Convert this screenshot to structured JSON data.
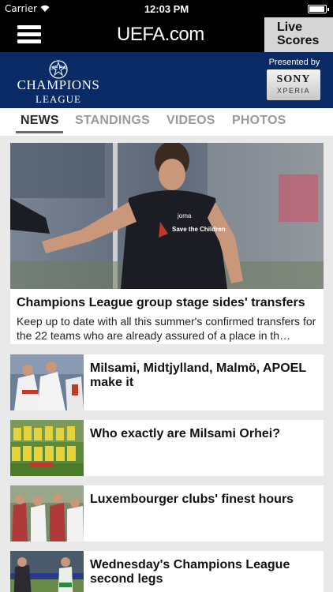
{
  "status_bar": {
    "carrier": "Carrier",
    "time": "12:03 PM"
  },
  "header": {
    "logo_text": "UEFA.com",
    "live_scores_line1": "Live",
    "live_scores_line2": "Scores"
  },
  "banner": {
    "logo_uefa": "UEFA",
    "logo_name": "CHAMPIONS",
    "logo_league": "LEAGUE",
    "presented_by": "Presented by",
    "sponsor": "SONY",
    "sponsor_sub": "XPERIA"
  },
  "tabs": [
    {
      "label": "NEWS",
      "active": true
    },
    {
      "label": "STANDINGS",
      "active": false
    },
    {
      "label": "VIDEOS",
      "active": false
    },
    {
      "label": "PHOTOS",
      "active": false
    }
  ],
  "lead_article": {
    "title": "Champions League group stage sides' transfers",
    "summary": "Keep up to date with all this summer's confirmed transfers for the 22 teams who are already assured of a place in th…",
    "shirt_brand": "joma",
    "shirt_sponsor": "Save the Children"
  },
  "articles": [
    {
      "title": "Milsami, Midtjylland, Malmö, APOEL make it"
    },
    {
      "title": "Who exactly are Milsami Orhei?"
    },
    {
      "title": "Luxembourger clubs' finest hours"
    },
    {
      "title": "Wednesday's Champions League second legs"
    }
  ],
  "colors": {
    "header": "#000000",
    "banner": "#0a2a66",
    "live_scores_bg": "#d6d6d6",
    "background": "#e9e9ea"
  }
}
